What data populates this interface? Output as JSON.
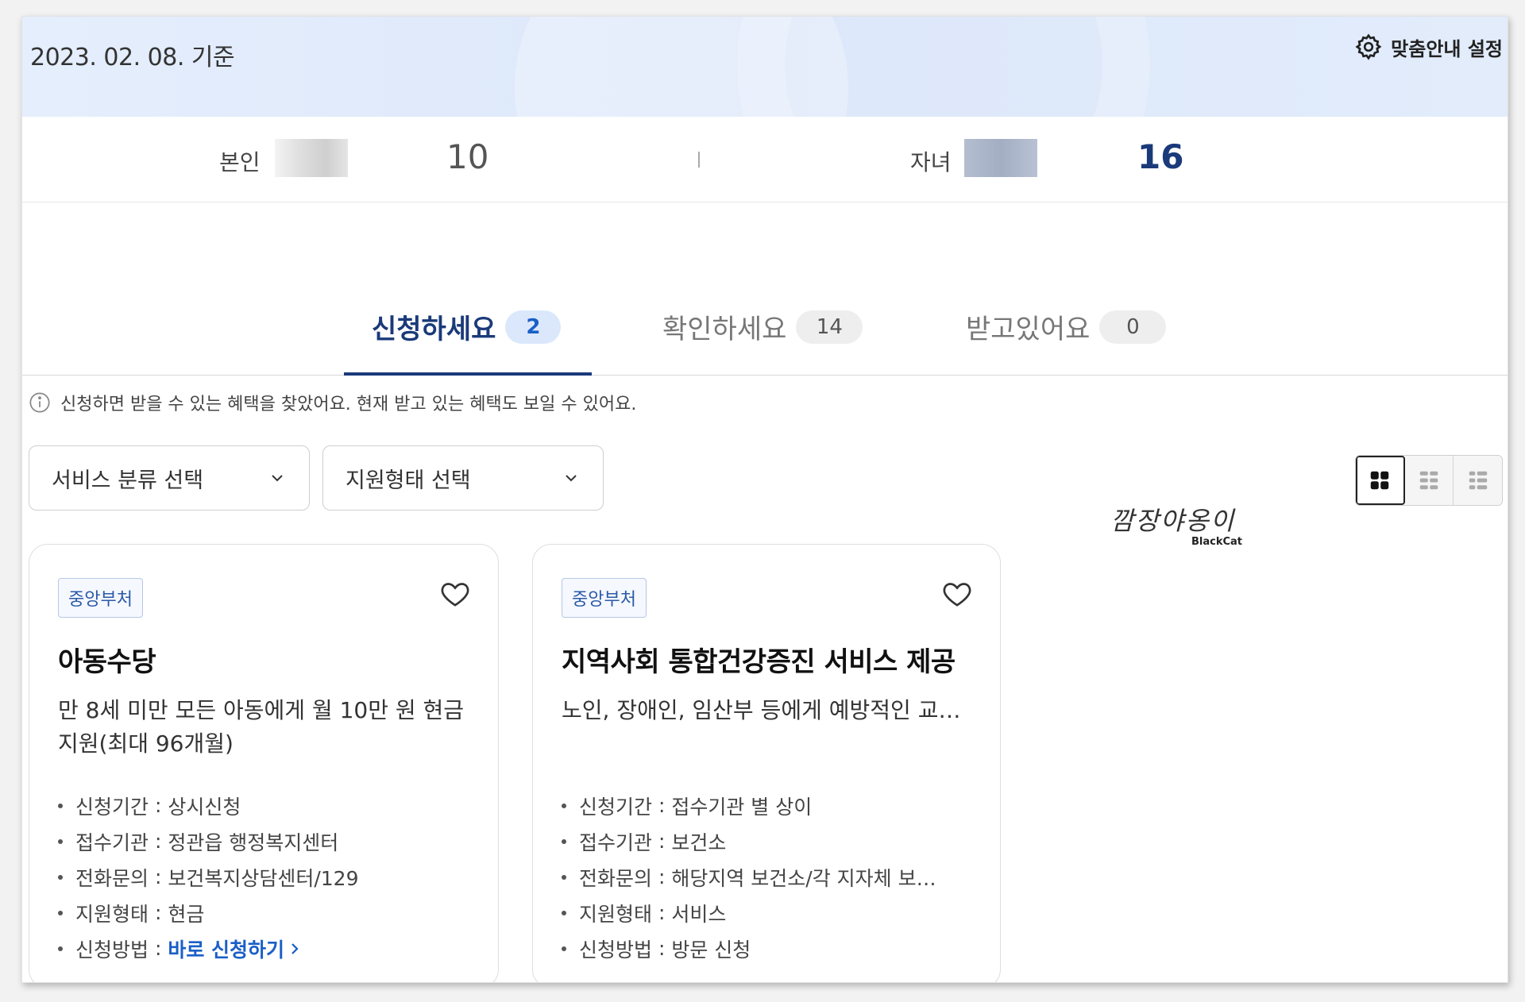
{
  "header": {
    "date_label": "2023. 02. 08. 기준",
    "settings_label": "맞춤안내 설정"
  },
  "people": {
    "self": {
      "label": "본인",
      "age": "10"
    },
    "child": {
      "label": "자녀",
      "age": "16"
    }
  },
  "tabs": [
    {
      "label": "신청하세요",
      "count": "2",
      "active": true
    },
    {
      "label": "확인하세요",
      "count": "14",
      "active": false
    },
    {
      "label": "받고있어요",
      "count": "0",
      "active": false
    }
  ],
  "info_text": "신청하면 받을 수 있는 혜택을 찾았어요. 현재 받고 있는 혜택도 보일 수 있어요.",
  "filters": {
    "service_category": "서비스 분류 선택",
    "support_type": "지원형태 선택"
  },
  "watermark": {
    "text": "깜장야옹이",
    "sub": "BlackCat"
  },
  "cards": [
    {
      "badge": "중앙부처",
      "title": "아동수당",
      "description": "만 8세 미만 모든 아동에게 월 10만 원 현금 지원(최대 96개월)",
      "details": [
        {
          "key": "신청기간",
          "value": "상시신청"
        },
        {
          "key": "접수기관",
          "value": "정관읍 행정복지센터"
        },
        {
          "key": "전화문의",
          "value": "보건복지상담센터/129"
        },
        {
          "key": "지원형태",
          "value": "현금"
        },
        {
          "key": "신청방법",
          "value": "바로 신청하기"
        }
      ]
    },
    {
      "badge": "중앙부처",
      "title": "지역사회 통합건강증진 서비스 제공",
      "description": "노인, 장애인, 임산부 등에게 예방적인 교…",
      "details": [
        {
          "key": "신청기간",
          "value": "접수기관 별 상이"
        },
        {
          "key": "접수기관",
          "value": "보건소"
        },
        {
          "key": "전화문의",
          "value": "해당지역 보건소/각 지자체 보…"
        },
        {
          "key": "지원형태",
          "value": "서비스"
        },
        {
          "key": "신청방법",
          "value": "방문 신청"
        }
      ]
    }
  ],
  "colors": {
    "primary_navy": "#1a3a7a",
    "link_blue": "#1a5fc6",
    "banner_bg": "#dce7fa"
  }
}
